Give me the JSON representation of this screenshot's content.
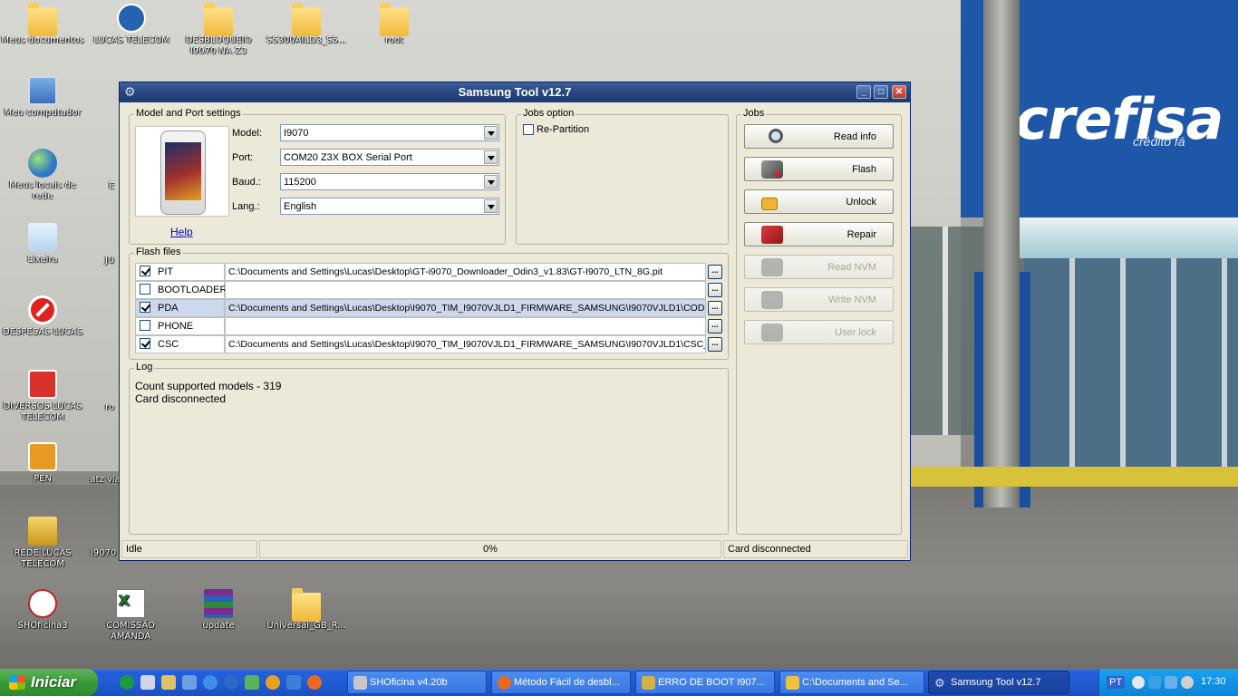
{
  "desktop": {
    "icons": [
      {
        "label": "Meus documentos"
      },
      {
        "label": "LUCAS TELECOM"
      },
      {
        "label": "DESBLOQUEIO I9070 NA Z3"
      },
      {
        "label": "S5300AILD3_S5..."
      },
      {
        "label": "root"
      },
      {
        "label": "Meu computador"
      },
      {
        "label": "Meus locais de rede"
      },
      {
        "label": "Lixeira"
      },
      {
        "label": "DESPESAS LUCAS"
      },
      {
        "label": "DIVERSOS LUCAS TELECOM"
      },
      {
        "label": "PEN"
      },
      {
        "label": "REDE LUCAS TELECOM"
      },
      {
        "label": "SHOficina3"
      },
      {
        "label": "COMISSÃO AMANDA"
      },
      {
        "label": "update"
      },
      {
        "label": "Universal_GB_R..."
      },
      {
        "label": "E"
      },
      {
        "label": "JU"
      },
      {
        "label": "ro"
      },
      {
        "label": "atz via"
      },
      {
        "label": "I9070"
      }
    ],
    "background_sign": {
      "brand": "crefisa",
      "sub": "crédito fá"
    }
  },
  "window": {
    "title": "Samsung Tool v12.7",
    "model_port": {
      "group_label": "Model and Port settings",
      "help_link": "Help",
      "model_label": "Model:",
      "model_value": "I9070",
      "port_label": "Port:",
      "port_value": "COM20 Z3X BOX Serial Port",
      "baud_label": "Baud.:",
      "baud_value": "115200",
      "lang_label": "Lang.:",
      "lang_value": "English"
    },
    "jobs_option": {
      "group_label": "Jobs option",
      "repartition_label": "Re-Partition",
      "repartition_checked": false
    },
    "flash_files": {
      "group_label": "Flash files",
      "browse_label": "...",
      "rows": [
        {
          "name": "PIT",
          "checked": true,
          "path": "C:\\Documents and Settings\\Lucas\\Desktop\\GT-i9070_Downloader_Odin3_v1.83\\GT-I9070_LTN_8G.pit"
        },
        {
          "name": "BOOTLOADER",
          "checked": false,
          "path": ""
        },
        {
          "name": "PDA",
          "checked": true,
          "path": "C:\\Documents and Settings\\Lucas\\Desktop\\I9070_TIM_I9070VJLD1_FIRMWARE_SAMSUNG\\I9070VJLD1\\COD"
        },
        {
          "name": "PHONE",
          "checked": false,
          "path": ""
        },
        {
          "name": "CSC",
          "checked": true,
          "path": "C:\\Documents and Settings\\Lucas\\Desktop\\I9070_TIM_I9070VJLD1_FIRMWARE_SAMSUNG\\I9070VJLD1\\CSC_"
        }
      ]
    },
    "log": {
      "group_label": "Log",
      "lines": [
        "Count supported models - 319",
        "Card disconnected"
      ]
    },
    "jobs": {
      "group_label": "Jobs",
      "buttons": [
        {
          "label": "Read info",
          "icon": "magnifier-icon",
          "enabled": true
        },
        {
          "label": "Flash",
          "icon": "flash-chip-icon",
          "enabled": true
        },
        {
          "label": "Unlock",
          "icon": "padlock-icon",
          "enabled": true
        },
        {
          "label": "Repair",
          "icon": "repair-toolbox-icon",
          "enabled": true
        },
        {
          "label": "Read NVM",
          "icon": "chip-icon",
          "enabled": false
        },
        {
          "label": "Write NVM",
          "icon": "chip-icon",
          "enabled": false
        },
        {
          "label": "User lock",
          "icon": "user-lock-icon",
          "enabled": false
        }
      ]
    },
    "status": {
      "state": "Idle",
      "progress": "0%",
      "card": "Card disconnected"
    }
  },
  "taskbar": {
    "start_label": "Iniciar",
    "tasks": [
      {
        "label": "SHOficina v4.20b",
        "active": false
      },
      {
        "label": "Método Fácil de desbl...",
        "active": false
      },
      {
        "label": "ERRO DE BOOT I907...",
        "active": false
      },
      {
        "label": "C:\\Documents and Se...",
        "active": false
      },
      {
        "label": "Samsung Tool v12.7",
        "active": true
      }
    ],
    "tray": {
      "language": "PT",
      "clock": "17:30"
    }
  },
  "colors": {
    "title_bar": "#27467f",
    "window_face": "#ece9d8",
    "selected_row": "#cdd8ec",
    "taskbar": "#245edb",
    "start_green": "#3a9a37",
    "link": "#0000cc"
  }
}
